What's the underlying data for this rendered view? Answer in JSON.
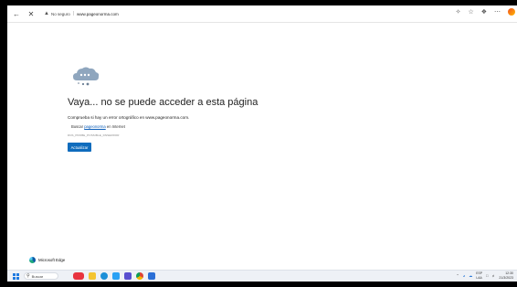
{
  "browser": {
    "security_label": "No seguro",
    "url": "www.pageonorma.com",
    "icons": [
      "back-icon",
      "close-icon",
      "warning-icon",
      "reader-icon",
      "favorite-icon",
      "collections-icon",
      "more-icon",
      "edge-profile-icon"
    ]
  },
  "error_page": {
    "title": "Vaya... no se puede acceder a esta página",
    "check_prefix": "Comprueba si hay un error ortográfico en ",
    "check_host": "www.pageonorma.com",
    "check_suffix": ".",
    "search_prefix": "Buscar ",
    "search_link": "pageonorma",
    "search_suffix": " en Internet",
    "error_code": "DNS_PROBE_POSSIBLE_DNSERROR",
    "refresh_label": "Actualizar"
  },
  "brand": {
    "name": "Microsoft Edge"
  },
  "taskbar": {
    "search_placeholder": "Buscar",
    "weather_temp": "ESP",
    "weather_sub": "LAA",
    "time": "12:30",
    "date": "21/3/2023",
    "accent": "#0f6cbd"
  }
}
